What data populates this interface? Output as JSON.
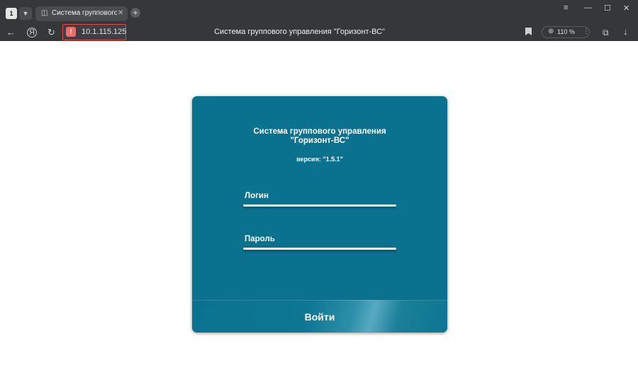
{
  "browser": {
    "tab_count": "1",
    "tab_title": "Система группового у",
    "url": "10.1.115.125",
    "page_title": "Система группового управления \"Горизонт-ВС\"",
    "zoom": "110 %",
    "icons": {
      "tab_list": "chevron-down-icon",
      "tab_close": "close-icon",
      "new_tab": "plus-icon",
      "back": "arrow-left-icon",
      "yandex": "yandex-icon",
      "reload": "reload-icon",
      "warning": "warning-icon",
      "bookmark": "bookmark-icon",
      "downloads": "download-icon"
    },
    "colors": {
      "chrome": "#36373b",
      "warning": "#f06c66",
      "address_border": "#e04a42"
    }
  },
  "card": {
    "title_line1": "Система группового управления",
    "title_line2": "\"Горизонт-ВС\"",
    "version": "версия: \"1.5.1\"",
    "login_label": "Логин",
    "login_value": "",
    "password_label": "Пароль",
    "password_value": "",
    "submit_label": "Войти",
    "colors": {
      "background": "#0a728f",
      "text": "#ffffff"
    }
  }
}
